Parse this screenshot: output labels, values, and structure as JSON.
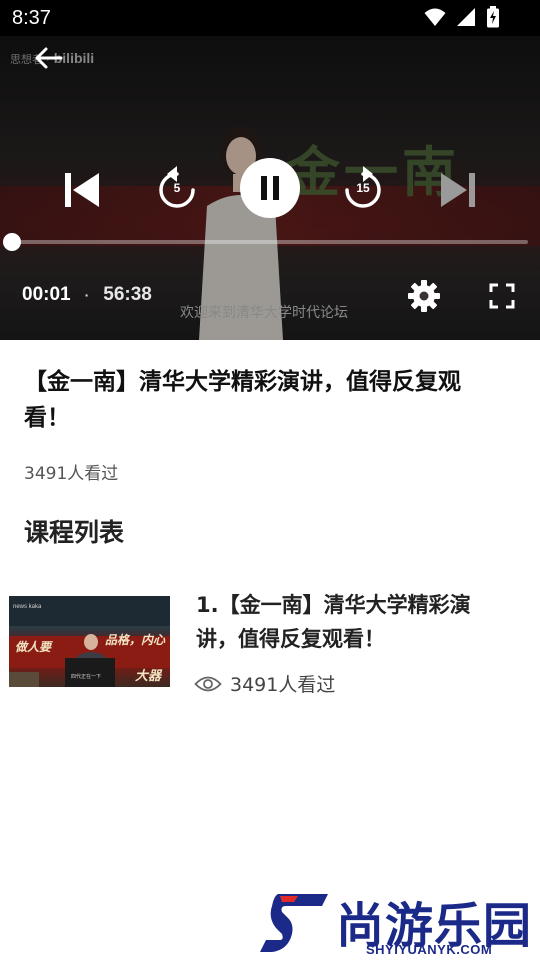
{
  "status_bar": {
    "time": "8:37"
  },
  "player": {
    "watermark_prefix": "思想者 ·",
    "watermark_brand": "bilibili",
    "background_text": "金一南",
    "caption": "欢迎来到清华大学时代论坛",
    "rewind_seconds": "5",
    "forward_seconds": "15",
    "current_time": "00:01",
    "separator": "·",
    "total_time": "56:38",
    "progress_fraction": 0.0003
  },
  "video": {
    "title": "【金一南】清华大学精彩演讲，值得反复观看！",
    "views": "3491人看过"
  },
  "course_list": {
    "heading": "课程列表",
    "items": [
      {
        "title": "1.【金一南】清华大学精彩演讲，值得反复观看！",
        "views": "3491人看过",
        "thumbnail_text_1": "做人要",
        "thumbnail_text_2": "品格，内心",
        "thumbnail_text_3": "大器"
      }
    ]
  },
  "site_watermark": {
    "name": "尚游乐园",
    "domain": "SHYIYUANYK.COM"
  },
  "colors": {
    "brand_blue": "#1b2a88",
    "brand_red": "#e02a2a",
    "status_bar": "#000000"
  }
}
